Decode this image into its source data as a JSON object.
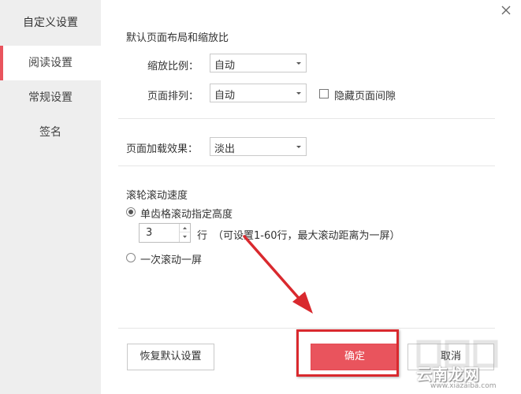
{
  "sidebar": {
    "title": "自定义设置",
    "items": [
      {
        "label": "阅读设置",
        "active": true
      },
      {
        "label": "常规设置",
        "active": false
      },
      {
        "label": "签名",
        "active": false
      }
    ]
  },
  "layout_section": {
    "title": "默认页面布局和缩放比",
    "zoom": {
      "label": "缩放比例：",
      "value": "自动"
    },
    "arrangement": {
      "label": "页面排列：",
      "value": "自动"
    },
    "hide_gap": {
      "label": "隐藏页面间隙",
      "checked": false
    }
  },
  "load_section": {
    "label": "页面加载效果：",
    "value": "淡出"
  },
  "scroll_section": {
    "title": "滚轮滚动速度",
    "option_height": {
      "label": "单齿格滚动指定高度",
      "checked": true
    },
    "lines": {
      "value": "3",
      "unit": "行",
      "hint": "（可设置1-60行，最大滚动距离为一屏）"
    },
    "option_screen": {
      "label": "一次滚动一屏",
      "checked": false
    }
  },
  "buttons": {
    "reset": "恢复默认设置",
    "ok": "确定",
    "cancel": "取消"
  },
  "watermark": {
    "name": "云南龙网",
    "url": "www.xiazaiba.com"
  },
  "colors": {
    "accent": "#e9545d",
    "annotation": "#d9292e",
    "sidebar_bg": "#eeeeee"
  }
}
